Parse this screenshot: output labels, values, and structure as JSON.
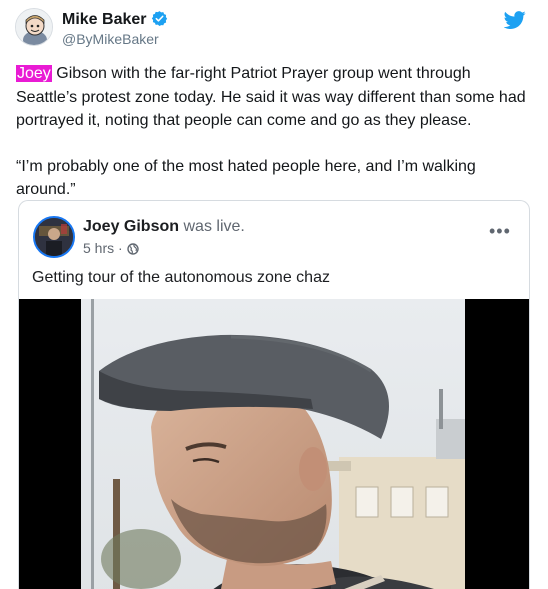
{
  "tweet": {
    "author_name": "Mike Baker",
    "author_handle": "@ByMikeBaker",
    "highlight_word": "Joey",
    "paragraph1_rest": " Gibson with the far-right Patriot Prayer group went through Seattle’s protest zone today. He said it was way different than some had portrayed it, noting that people can come and go as they please.",
    "paragraph2": "“I’m probably one of the most hated people here, and I’m walking around.”"
  },
  "embed": {
    "author_name": "Joey Gibson",
    "status": "was live.",
    "time": "5 hrs",
    "separator": "·",
    "caption": "Getting tour of the autonomous zone chaz",
    "more_label": "•••"
  },
  "colors": {
    "highlight": "#e91bd4",
    "twitter_blue": "#1da1f2",
    "facebook_blue": "#1877f2"
  },
  "icons": {
    "verified": "verified-badge-icon",
    "twitter": "twitter-bird-icon",
    "globe": "globe-icon",
    "more": "more-options-icon"
  }
}
